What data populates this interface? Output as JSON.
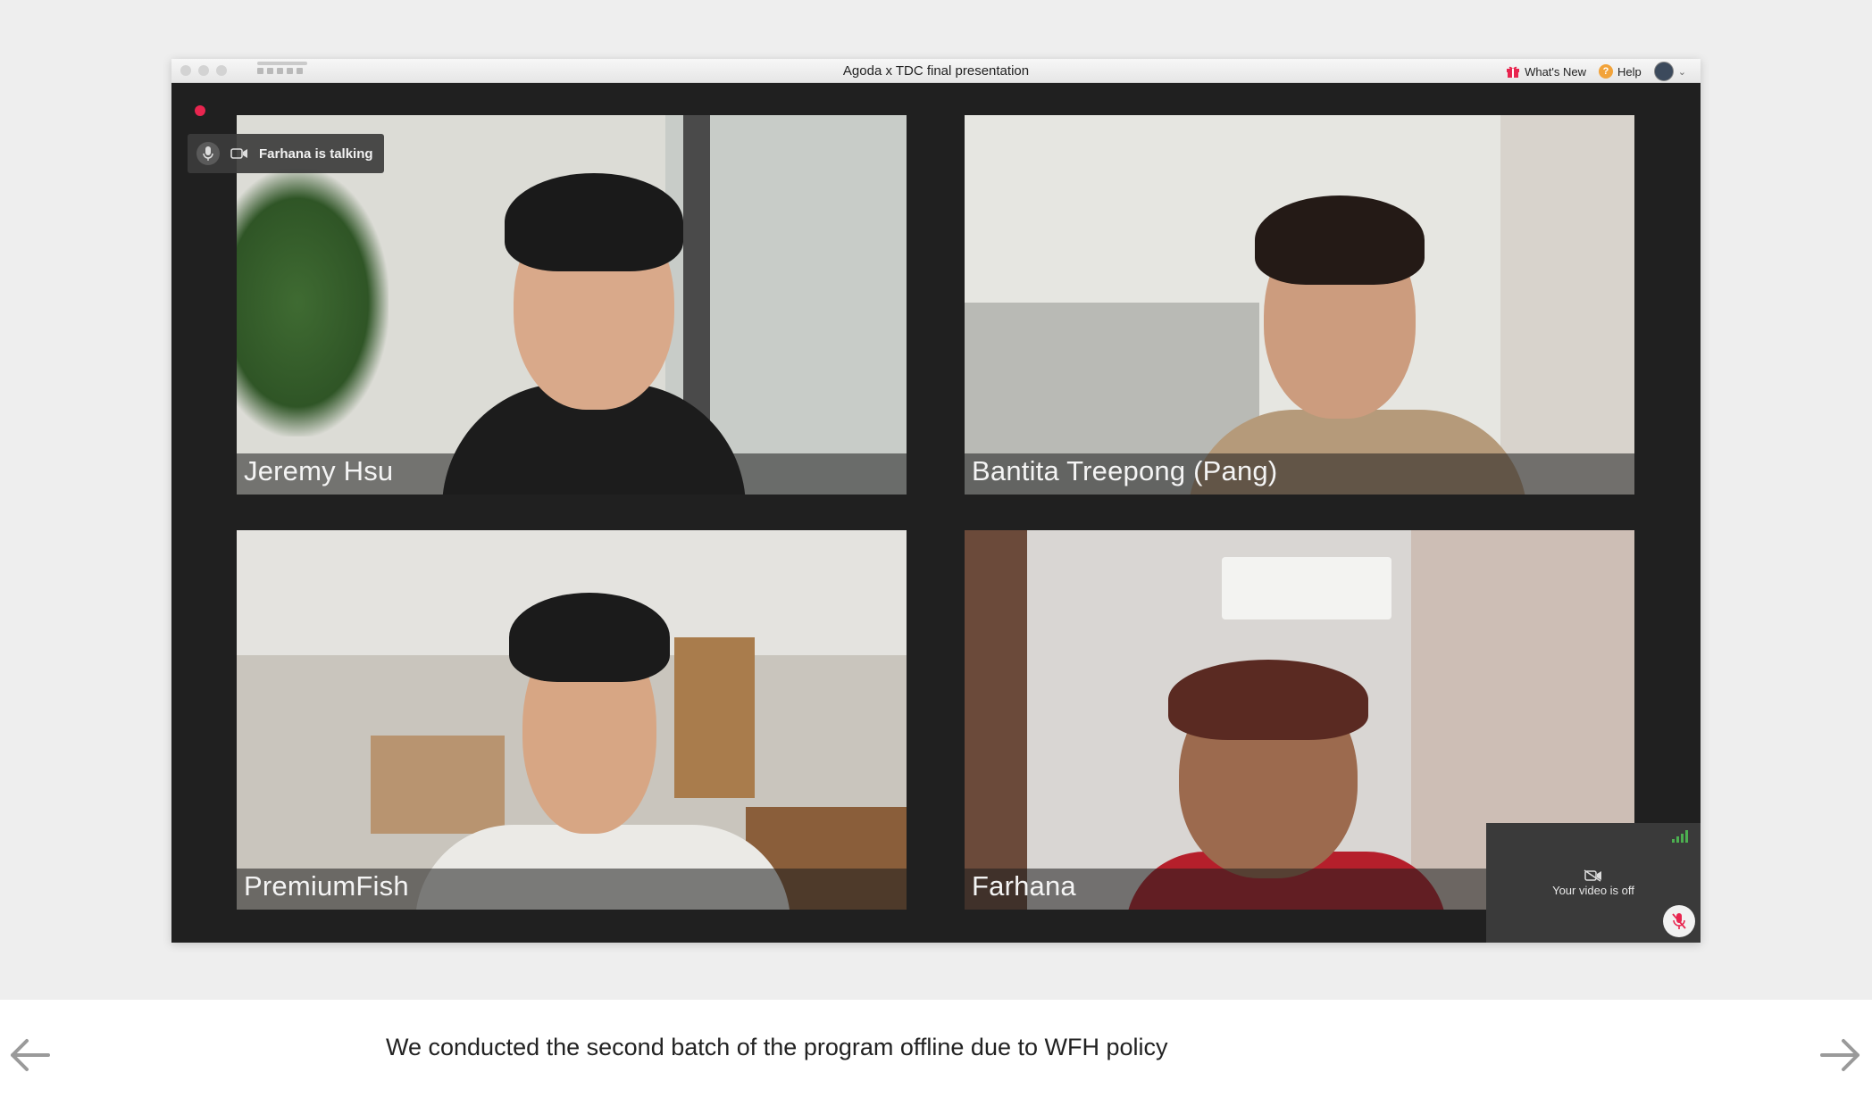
{
  "window": {
    "title": "Agoda x TDC final presentation",
    "whats_new": "What's New",
    "help": "Help"
  },
  "talking_indicator": {
    "label": "Farhana is talking"
  },
  "participants": [
    {
      "name": "Jeremy Hsu"
    },
    {
      "name": "Bantita Treepong (Pang)"
    },
    {
      "name": "PremiumFish"
    },
    {
      "name": "Farhana"
    }
  ],
  "self_view": {
    "status": "Your video is off"
  },
  "caption": {
    "text": "We conducted the second batch of the program offline due to WFH policy"
  },
  "colors": {
    "record": "#e8254f",
    "signal": "#4caf50",
    "mute": "#e8254f"
  },
  "icons": [
    "gift-icon",
    "help-icon",
    "avatar",
    "mic-icon",
    "camera-icon",
    "signal-icon",
    "camera-off-icon",
    "mic-muted-icon",
    "arrow-left-icon",
    "arrow-right-icon"
  ]
}
